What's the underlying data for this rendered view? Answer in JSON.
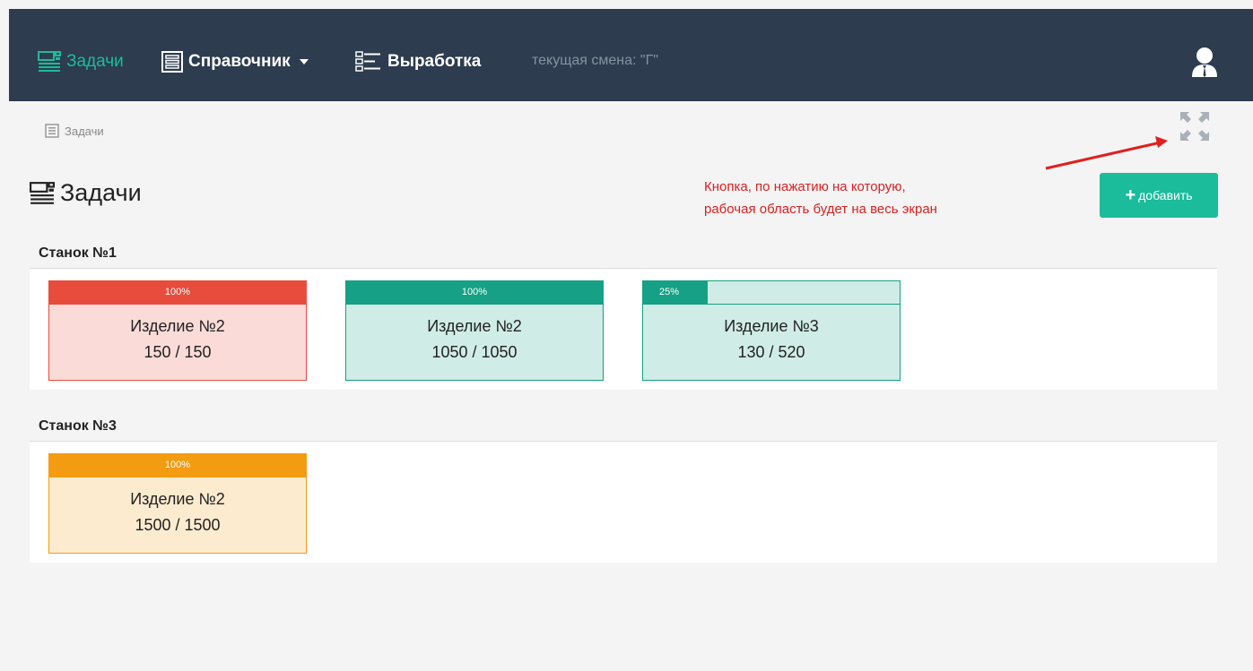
{
  "nav": {
    "tasks_label": "Задачи",
    "reference_label": "Справочник",
    "output_label": "Выработка",
    "current_shift": "текущая смена: \"Г\""
  },
  "breadcrumb": {
    "label": "Задачи"
  },
  "page": {
    "title": "Задачи",
    "add_button_label": "добавить",
    "annotation_line1": "Кнопка, по нажатию на которую,",
    "annotation_line2": "рабочая область будет на весь экран"
  },
  "colors": {
    "navbar_bg": "#2d3c4f",
    "accent": "#1abc9c",
    "red": "#e74c3c",
    "teal": "#16a085",
    "orange": "#f39c12",
    "annotation": "#e02020"
  },
  "icons": {
    "tasks": "list-icon",
    "reference": "grid-list-icon",
    "output": "tree-list-icon",
    "user": "user-icon",
    "fullscreen": "expand-arrows-icon",
    "add": "plus-icon"
  },
  "machines": [
    {
      "name": "Станок №1",
      "tasks": [
        {
          "progress_label": "100%",
          "progress": 1.0,
          "product": "Изделие №2",
          "quantity": "150 / 150",
          "color": "red"
        },
        {
          "progress_label": "100%",
          "progress": 1.0,
          "product": "Изделие №2",
          "quantity": "1050 / 1050",
          "color": "teal"
        },
        {
          "progress_label": "25%",
          "progress": 0.25,
          "product": "Изделие №3",
          "quantity": "130 / 520",
          "color": "teal"
        }
      ]
    },
    {
      "name": "Станок №3",
      "tasks": [
        {
          "progress_label": "100%",
          "progress": 1.0,
          "product": "Изделие №2",
          "quantity": "1500 / 1500",
          "color": "orange"
        }
      ]
    }
  ]
}
